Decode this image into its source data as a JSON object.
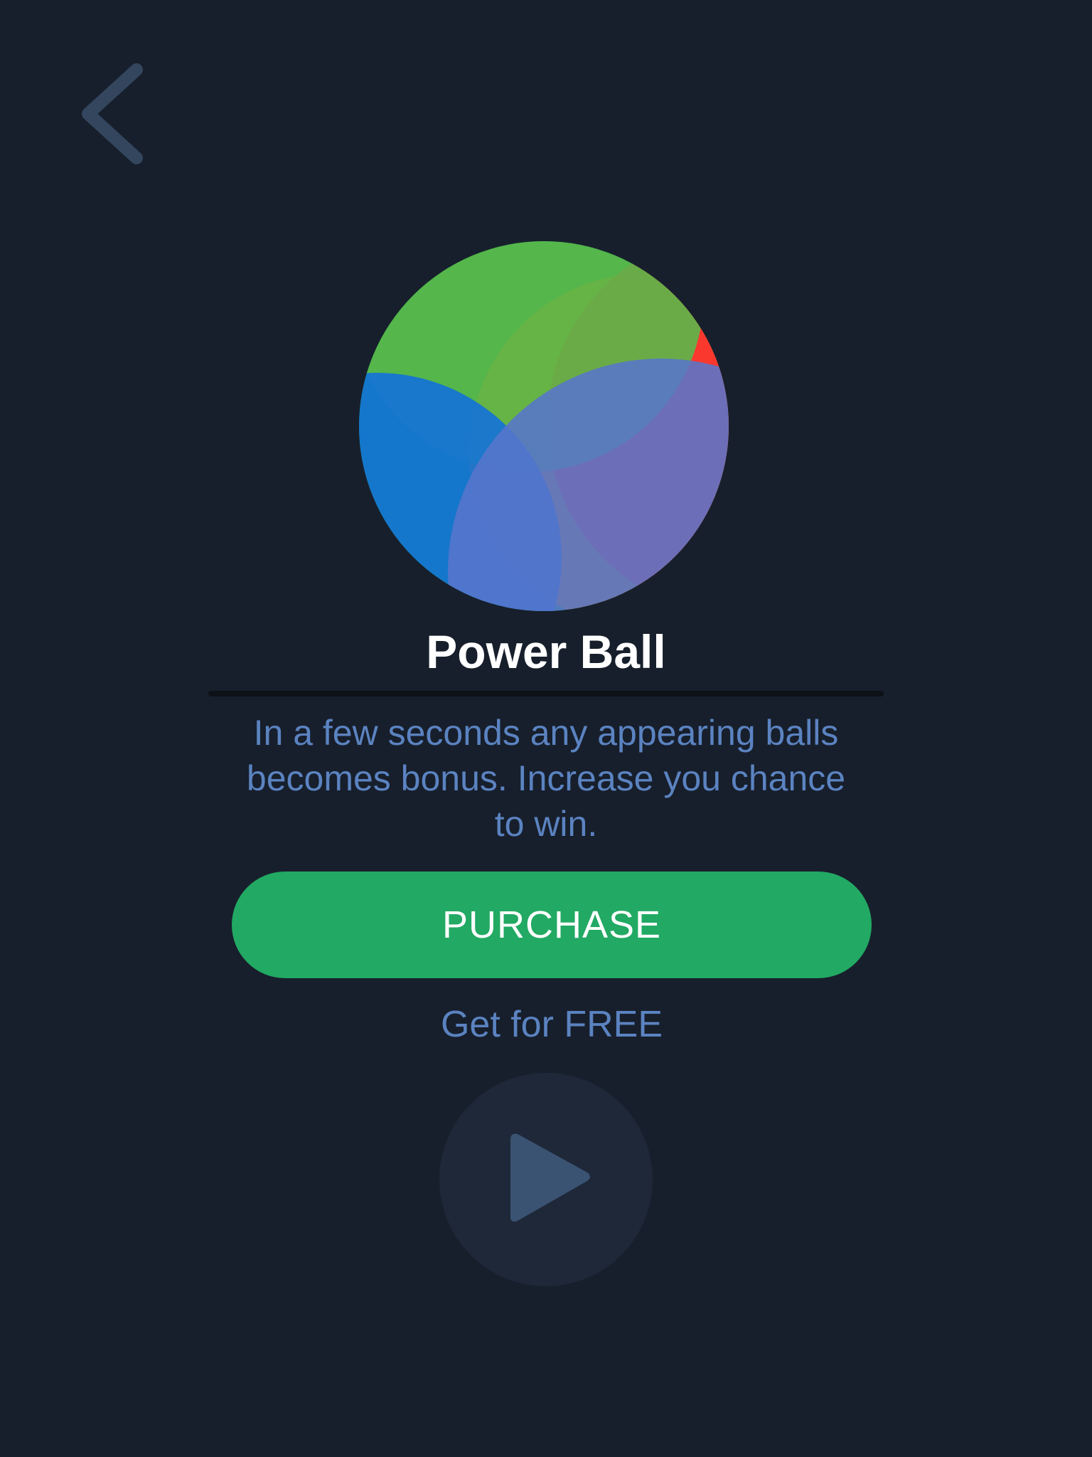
{
  "colors": {
    "background": "#171f2c",
    "accent_green": "#22a963",
    "text_blue": "#5b83c1",
    "icon_slate": "#33465e"
  },
  "icons": {
    "back": "chevron-left-icon",
    "item": "power-ball-icon",
    "play": "play-icon"
  },
  "item": {
    "title": "Power Ball",
    "description": "In a few seconds any appearing balls becomes bonus. Increase you chance to win."
  },
  "actions": {
    "purchase_label": "PURCHASE",
    "free_label": "Get for FREE"
  }
}
